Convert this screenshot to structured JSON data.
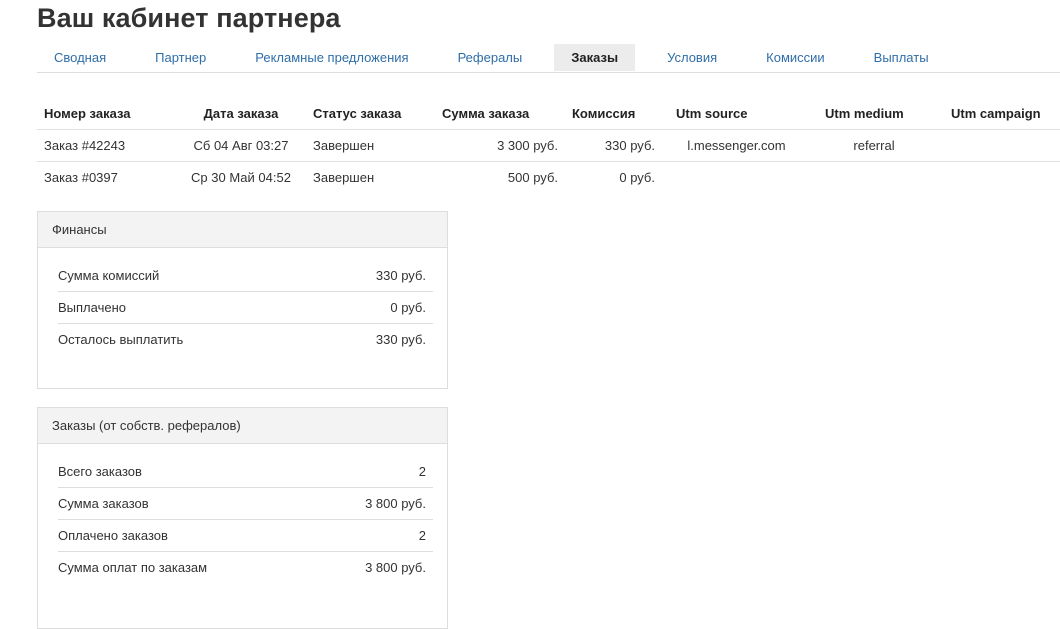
{
  "page": {
    "title": "Ваш кабинет партнера"
  },
  "tabs": [
    {
      "label": "Сводная",
      "active": false
    },
    {
      "label": "Партнер",
      "active": false
    },
    {
      "label": "Рекламные предложения",
      "active": false
    },
    {
      "label": "Рефералы",
      "active": false
    },
    {
      "label": "Заказы",
      "active": true
    },
    {
      "label": "Условия",
      "active": false
    },
    {
      "label": "Комиссии",
      "active": false
    },
    {
      "label": "Выплаты",
      "active": false
    }
  ],
  "orders": {
    "columns": [
      "Номер заказа",
      "Дата заказа",
      "Статус заказа",
      "Сумма заказа",
      "Комиссия",
      "Utm source",
      "Utm medium",
      "Utm campaign"
    ],
    "rows": [
      [
        "Заказ #42243",
        "Сб 04 Авг 03:27",
        "Завершен",
        "3 300 руб.",
        "330 руб.",
        "l.messenger.com",
        "referral",
        ""
      ],
      [
        "Заказ #0397",
        "Ср 30 Май 04:52",
        "Завершен",
        "500 руб.",
        "0 руб.",
        "",
        "",
        ""
      ]
    ]
  },
  "finance": {
    "title": "Финансы",
    "rows": [
      {
        "label": "Сумма комиссий",
        "value": "330 руб."
      },
      {
        "label": "Выплачено",
        "value": "0 руб."
      },
      {
        "label": "Осталось выплатить",
        "value": "330 руб."
      }
    ]
  },
  "referral_orders": {
    "title": "Заказы (от собств. рефералов)",
    "rows": [
      {
        "label": "Всего заказов",
        "value": "2"
      },
      {
        "label": "Сумма заказов",
        "value": "3 800 руб."
      },
      {
        "label": "Оплачено заказов",
        "value": "2"
      },
      {
        "label": "Сумма оплат по заказам",
        "value": "3 800 руб."
      }
    ]
  }
}
